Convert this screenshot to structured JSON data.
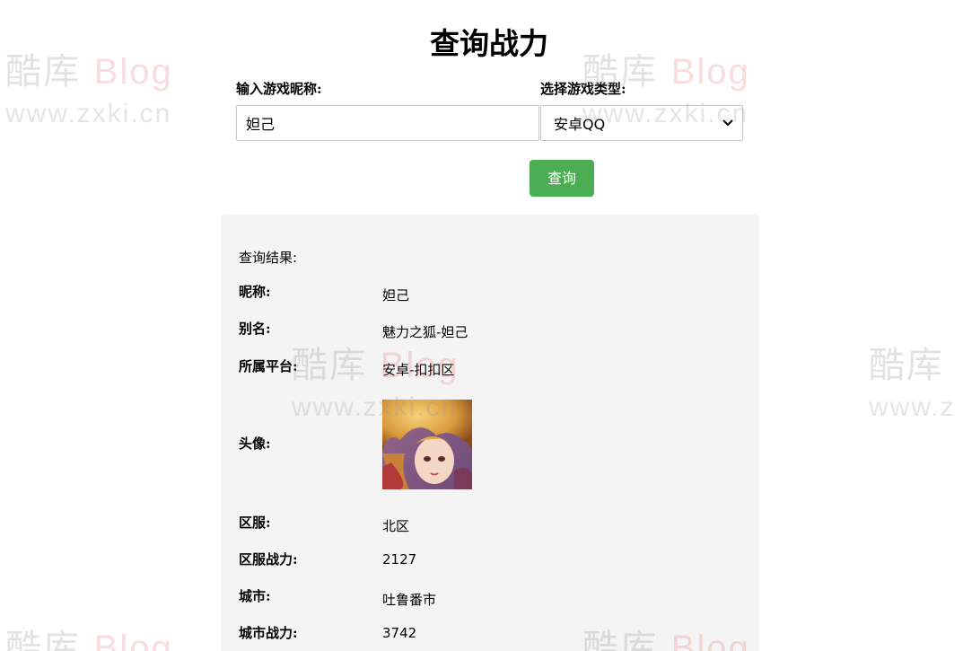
{
  "header": {
    "title": "查询战力"
  },
  "form": {
    "nickname_label": "输入游戏昵称:",
    "nickname_value": "妲己",
    "type_label": "选择游戏类型:",
    "type_selected": "安卓QQ",
    "submit_label": "查询"
  },
  "result": {
    "title": "查询结果:",
    "rows": [
      {
        "key": "昵称:",
        "value": "妲己"
      },
      {
        "key": "别名:",
        "value": "魅力之狐-妲己"
      },
      {
        "key": "所属平台:",
        "value": "安卓-扣扣区"
      },
      {
        "key": "头像:",
        "value": ""
      },
      {
        "key": "区服:",
        "value": "北区"
      },
      {
        "key": "区服战力:",
        "value": "2127"
      },
      {
        "key": "城市:",
        "value": "吐鲁番市"
      },
      {
        "key": "城市战力:",
        "value": "3742"
      }
    ]
  },
  "watermark": {
    "brand_cn": "酷库",
    "brand_en": "Blog",
    "url": "www.zxki.cn",
    "url_short": "www.z"
  },
  "colors": {
    "button": "#4cae52",
    "panel": "#f4f4f4"
  }
}
